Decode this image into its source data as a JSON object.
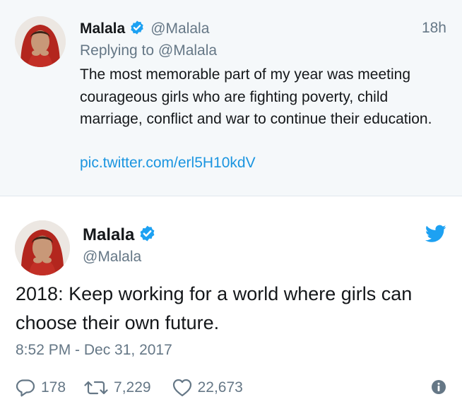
{
  "reply_tweet": {
    "name": "Malala",
    "handle": "@Malala",
    "time_ago": "18h",
    "replying_prefix": "Replying to",
    "replying_to": "@Malala",
    "text": "The most memorable part of my year was meeting courageous girls who are fighting poverty, child marriage, conflict and war to continue their education.",
    "link": "pic.twitter.com/erl5H10kdV"
  },
  "main_tweet": {
    "name": "Malala",
    "handle": "@Malala",
    "text": "2018: Keep working for a world where girls can choose their own future.",
    "timestamp": "8:52 PM - Dec 31, 2017",
    "replies": "178",
    "retweets": "7,229",
    "likes": "22,673"
  },
  "icons": {
    "verified": "verified-badge-icon",
    "bird": "twitter-bird-icon",
    "reply": "reply-icon",
    "retweet": "retweet-icon",
    "like": "heart-icon",
    "info": "info-icon"
  },
  "colors": {
    "brand_blue": "#1da1f2",
    "link_blue": "#1b95e0",
    "muted_gray": "#657786",
    "reply_background": "#f5f8fa",
    "text_dark": "#14171a"
  }
}
